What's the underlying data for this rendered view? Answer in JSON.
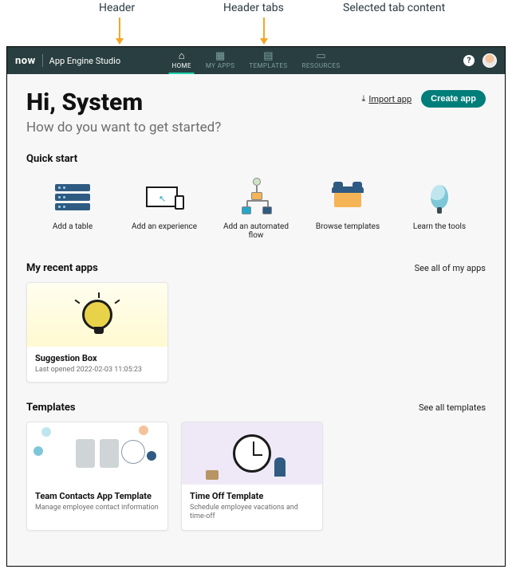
{
  "annotations": {
    "header": "Header",
    "header_tabs": "Header tabs",
    "selected_tab": "Selected tab content"
  },
  "brand": {
    "logo": "now",
    "product": "App Engine Studio"
  },
  "nav": {
    "tabs": [
      {
        "label": "HOME",
        "icon": "home-icon",
        "glyph": "⌂",
        "active": true
      },
      {
        "label": "MY APPS",
        "icon": "apps-icon",
        "glyph": "▦",
        "active": false
      },
      {
        "label": "TEMPLATES",
        "icon": "templates-icon",
        "glyph": "▤",
        "active": false
      },
      {
        "label": "RESOURCES",
        "icon": "resources-icon",
        "glyph": "▭",
        "active": false
      }
    ]
  },
  "hero": {
    "title": "Hi, System",
    "subtitle": "How do you want to get started?",
    "import_label": "Import app",
    "create_label": "Create app"
  },
  "quick_start": {
    "heading": "Quick start",
    "tiles": [
      {
        "label": "Add a table"
      },
      {
        "label": "Add an experience"
      },
      {
        "label": "Add an automated flow"
      },
      {
        "label": "Browse templates"
      },
      {
        "label": "Learn the tools"
      }
    ]
  },
  "recent": {
    "heading": "My recent apps",
    "see_all": "See all of my apps",
    "apps": [
      {
        "title": "Suggestion Box",
        "last_opened": "Last opened 2022-02-03 11:05:23"
      }
    ]
  },
  "templates": {
    "heading": "Templates",
    "see_all": "See all templates",
    "items": [
      {
        "title": "Team Contacts App Template",
        "desc": "Manage employee contact information"
      },
      {
        "title": "Time Off Template",
        "desc": "Schedule employee vacations and time-off"
      }
    ]
  },
  "colors": {
    "header_bg": "#293e40",
    "accent": "#007e7a",
    "tab_active": "#1ed2af"
  }
}
